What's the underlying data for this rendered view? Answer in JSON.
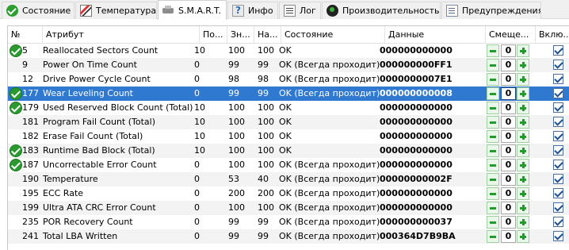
{
  "tabs": [
    {
      "label": "Состояние",
      "icon": "check-icon",
      "active": false
    },
    {
      "label": "Температура",
      "icon": "thermometer-icon",
      "active": false
    },
    {
      "label": "S.M.A.R.T.",
      "icon": "drive-icon",
      "active": true
    },
    {
      "label": "Инфо",
      "icon": "info-icon",
      "active": false
    },
    {
      "label": "Лог",
      "icon": "log-icon",
      "active": false
    },
    {
      "label": "Производительность",
      "icon": "performance-icon",
      "active": false
    },
    {
      "label": "Предупреждения",
      "icon": "warnings-icon",
      "active": false
    }
  ],
  "columns": {
    "num": "№",
    "attr": "Атрибут",
    "threshold": "По...",
    "value": "Зн...",
    "worst": "На...",
    "status": "Состояние",
    "data": "Данные",
    "offset": "Смеще...",
    "enabled": "Вклю..."
  },
  "rows": [
    {
      "ok": true,
      "id": "5",
      "name": "Reallocated Sectors Count",
      "thr": "10",
      "val": "100",
      "worst": "100",
      "status": "OK",
      "data": "000000000000",
      "offset": "0",
      "enabled": true
    },
    {
      "ok": false,
      "id": "9",
      "name": "Power On Time Count",
      "thr": "0",
      "val": "99",
      "worst": "99",
      "status": "OK (Всегда проходит)",
      "data": "000000000FF1",
      "offset": "0",
      "enabled": true
    },
    {
      "ok": false,
      "id": "12",
      "name": "Drive Power Cycle Count",
      "thr": "0",
      "val": "98",
      "worst": "98",
      "status": "OK (Всегда проходит)",
      "data": "0000000007E1",
      "offset": "0",
      "enabled": true
    },
    {
      "ok": true,
      "id": "177",
      "name": "Wear Leveling Count",
      "thr": "0",
      "val": "99",
      "worst": "99",
      "status": "OK (Всегда проходит)",
      "data": "000000000008",
      "offset": "0",
      "enabled": true,
      "selected": true
    },
    {
      "ok": true,
      "id": "179",
      "name": "Used Reserved Block Count (Total)",
      "thr": "10",
      "val": "100",
      "worst": "100",
      "status": "OK",
      "data": "000000000000",
      "offset": "0",
      "enabled": true
    },
    {
      "ok": false,
      "id": "181",
      "name": "Program Fail Count (Total)",
      "thr": "10",
      "val": "100",
      "worst": "100",
      "status": "OK",
      "data": "000000000000",
      "offset": "0",
      "enabled": true
    },
    {
      "ok": false,
      "id": "182",
      "name": "Erase Fail Count (Total)",
      "thr": "10",
      "val": "100",
      "worst": "100",
      "status": "OK",
      "data": "000000000000",
      "offset": "0",
      "enabled": true
    },
    {
      "ok": true,
      "id": "183",
      "name": "Runtime Bad Block (Total)",
      "thr": "10",
      "val": "100",
      "worst": "100",
      "status": "OK",
      "data": "000000000000",
      "offset": "0",
      "enabled": true
    },
    {
      "ok": true,
      "id": "187",
      "name": "Uncorrectable Error Count",
      "thr": "0",
      "val": "100",
      "worst": "100",
      "status": "OK (Всегда проходит)",
      "data": "000000000000",
      "offset": "0",
      "enabled": true
    },
    {
      "ok": false,
      "id": "190",
      "name": "Temperature",
      "thr": "0",
      "val": "53",
      "worst": "40",
      "status": "OK (Всегда проходит)",
      "data": "00000000002F",
      "offset": "0",
      "enabled": true
    },
    {
      "ok": false,
      "id": "195",
      "name": "ECC Rate",
      "thr": "0",
      "val": "200",
      "worst": "200",
      "status": "OK (Всегда проходит)",
      "data": "000000000000",
      "offset": "0",
      "enabled": true
    },
    {
      "ok": false,
      "id": "199",
      "name": "Ultra ATA CRC Error Count",
      "thr": "0",
      "val": "100",
      "worst": "100",
      "status": "OK (Всегда проходит)",
      "data": "000000000000",
      "offset": "0",
      "enabled": true
    },
    {
      "ok": false,
      "id": "235",
      "name": "POR Recovery Count",
      "thr": "0",
      "val": "99",
      "worst": "99",
      "status": "OK (Всегда проходит)",
      "data": "000000000037",
      "offset": "0",
      "enabled": true
    },
    {
      "ok": false,
      "id": "241",
      "name": "Total LBA Written",
      "thr": "0",
      "val": "99",
      "worst": "99",
      "status": "OK (Всегда проходит)",
      "data": "000364D7B9BA",
      "offset": "0",
      "enabled": true
    }
  ],
  "colors": {
    "selection": "#3079d0",
    "ok_green": "#2a9a2e",
    "alt_row": "#f3f3f3"
  }
}
